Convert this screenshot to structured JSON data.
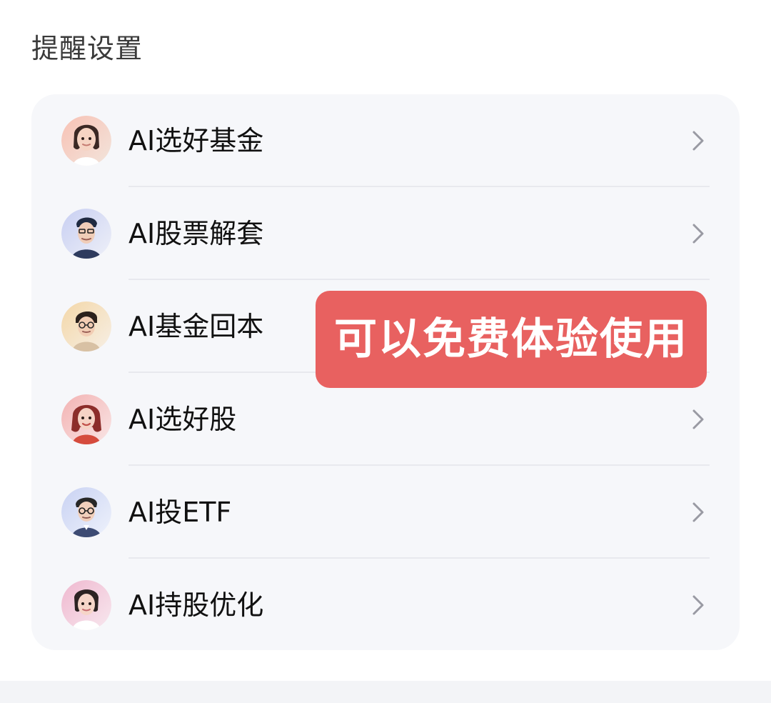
{
  "section": {
    "title": "提醒设置"
  },
  "items": [
    {
      "label": "AI选好基金",
      "avatar": "female-advisor-avatar"
    },
    {
      "label": "AI股票解套",
      "avatar": "male-hipster-avatar"
    },
    {
      "label": "AI基金回本",
      "avatar": "male-glasses-avatar"
    },
    {
      "label": "AI选好股",
      "avatar": "female-red-hair-avatar"
    },
    {
      "label": "AI投ETF",
      "avatar": "male-suit-glasses-avatar"
    },
    {
      "label": "AI持股优化",
      "avatar": "female-pink-avatar"
    }
  ],
  "overlay": {
    "promo_text": "可以免费体验使用",
    "background_color": "#e86160",
    "text_color": "#ffffff"
  },
  "icons": {
    "chevron": "chevron-right-icon"
  }
}
